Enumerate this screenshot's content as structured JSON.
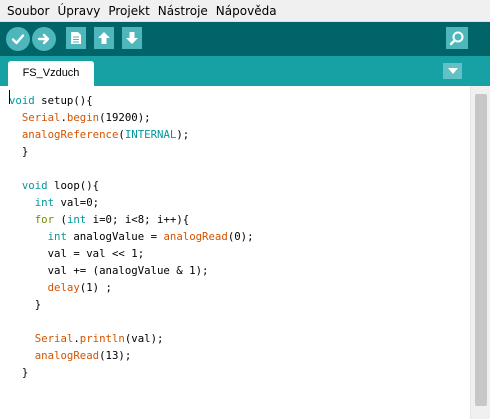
{
  "menubar": {
    "items": [
      "Soubor",
      "Úpravy",
      "Projekt",
      "Nástroje",
      "Nápověda"
    ]
  },
  "toolbar": {
    "buttons": [
      {
        "name": "verify",
        "icon": "check-icon"
      },
      {
        "name": "upload",
        "icon": "arrow-right-icon"
      },
      {
        "name": "new",
        "icon": "document-icon"
      },
      {
        "name": "open",
        "icon": "arrow-up-icon"
      },
      {
        "name": "save",
        "icon": "arrow-down-icon"
      },
      {
        "name": "serial-monitor",
        "icon": "magnifier-icon"
      }
    ]
  },
  "tabs": {
    "active_label": "FS_Vzduch"
  },
  "editor": {
    "lines": [
      "void setup(){",
      "  Serial.begin(19200);",
      "  analogReference(INTERNAL);",
      "  }",
      "",
      "  void loop(){",
      "    int val=0;",
      "    for (int i=0; i<8; i++){",
      "      int analogValue = analogRead(0);",
      "      val = val << 1;",
      "      val += (analogValue & 1);",
      "      delay(1) ;",
      "    }",
      "",
      "    Serial.println(val);",
      "    analogRead(13);",
      "  }"
    ]
  },
  "colors": {
    "toolbar": "#006468",
    "tabbar": "#17a1a5",
    "button": "#4db7bb",
    "type_keyword": "#00979c",
    "control_keyword": "#728e00",
    "function": "#d35400"
  }
}
